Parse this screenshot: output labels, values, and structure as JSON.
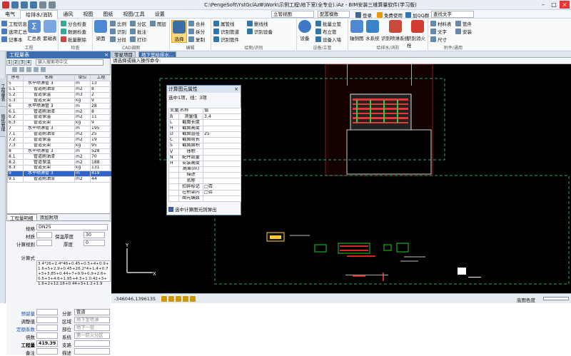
{
  "title": "C:\\PengeSoft\\YstGclAzⅢ\\Work\\示例工程\\地下室(全专业).iAz - BIM安装三维算量软件(学习版)",
  "menus": [
    "电气",
    "给排水/消防",
    "通风",
    "视图",
    "图纸",
    "视图/工具",
    "设置"
  ],
  "active_menu": "给排水/消防",
  "ribbon": {
    "engineering": {
      "items": [
        "工程信息",
        "选项汇总",
        "记事本",
        "汇总表",
        "套磁表"
      ],
      "label": "工程"
    },
    "check": {
      "items": [
        "分合检查",
        "数据检查",
        "批量删除"
      ],
      "label": "检查"
    },
    "cad": {
      "items": [
        "比例",
        "分区",
        "识别",
        "分段",
        "批注",
        "打印",
        "图层",
        "梁面"
      ],
      "label": "CAD调图"
    },
    "edit": {
      "items": [
        "选择",
        "合并",
        "拆分",
        "复制"
      ],
      "label": "编辑"
    },
    "draw": {
      "items": [
        "属管线",
        "识别管道",
        "识别管件",
        "删线线",
        "识别设备"
      ],
      "label": "绘制/识别"
    },
    "equip": {
      "items": [
        "设备",
        "批量立管",
        "布立管",
        "设备入墙"
      ],
      "label": "设备/立管"
    },
    "fire": {
      "items": [
        "轴侧图",
        "水系统",
        "识别喷淋系统",
        "识别消火栓"
      ],
      "label": "给排水/消防"
    },
    "misc": {
      "items": [
        "材料表",
        "管件",
        "文字",
        "安装",
        "尺寸"
      ],
      "label": "附件/通用"
    },
    "view_select": "立管视图",
    "match_select": "配置模数",
    "login": "登录",
    "fav": "免费使用",
    "qq": "加QQ群",
    "search": "查找文字"
  },
  "panel": {
    "title": "工程量表",
    "search_placeholder": "输入搜索项中文",
    "sidetabs": [
      "工程量表",
      "图纸管理"
    ],
    "columns": [
      "序号",
      "名称",
      "单位",
      "工程"
    ],
    "rows": [
      {
        "n": "5",
        "name": "水平喷淋管 3",
        "u": "m",
        "v": "13"
      },
      {
        "n": "5.1",
        "name": "管道刷油漆",
        "u": "m2",
        "v": "8"
      },
      {
        "n": "5.2",
        "name": "管道保温",
        "u": "m3",
        "v": "2"
      },
      {
        "n": "5.3",
        "name": "管道支架",
        "u": "kg",
        "v": "9"
      },
      {
        "n": "6",
        "name": "水平喷淋管 3",
        "u": "m",
        "v": "28"
      },
      {
        "n": "6.1",
        "name": "管道刷油漆",
        "u": "m2",
        "v": "8"
      },
      {
        "n": "6.2",
        "name": "管道保温",
        "u": "m2",
        "v": "11"
      },
      {
        "n": "6.3",
        "name": "管道支架",
        "u": "kg",
        "v": "9"
      },
      {
        "n": "7",
        "name": "水平喷淋管 3",
        "u": "m",
        "v": "195"
      },
      {
        "n": "7.1",
        "name": "管道刷油漆",
        "u": "m2",
        "v": "25"
      },
      {
        "n": "7.2",
        "name": "管道保温",
        "u": "m2",
        "v": "19"
      },
      {
        "n": "7.3",
        "name": "管道支架",
        "u": "kg",
        "v": "95"
      },
      {
        "n": "8",
        "name": "水平喷淋管 3",
        "u": "m",
        "v": "528"
      },
      {
        "n": "8.1",
        "name": "管道刷油漆",
        "u": "m2",
        "v": "70"
      },
      {
        "n": "8.2",
        "name": "管道保温",
        "u": "m2",
        "v": "188"
      },
      {
        "n": "8.3",
        "name": "管道支架",
        "u": "kg",
        "v": "131"
      },
      {
        "n": "9",
        "name": "水平喷淋管 3",
        "u": "m",
        "v": "419"
      },
      {
        "n": "9.1",
        "name": "管道刷油漆",
        "u": "m2",
        "v": "44"
      }
    ],
    "selected_row": 16,
    "detail_tabs": [
      "工程量明细",
      "添加附项"
    ],
    "props": {
      "spec_label": "规格",
      "spec": "DN25",
      "material_label": "材质",
      "insulation_label": "保温厚度",
      "insulation": "30",
      "rule_label": "计算规则",
      "thickness_label": "厚度",
      "thickness": "0",
      "formula_label": "计算式",
      "formula": "3.4*26+2.4*46+0.45+0.5+4+0.9+1.6+5+2.9+0.45+26.2*4+1.4+0.7+3+3.85+0.44+7+0.9+0.9+2.6+0.5+3+4.6+1.95+4.3+1.0.42+3+1.6+2+12.18+0.44+3+1.2+1.9",
      "config_label": "预留量",
      "partition_label": "分部",
      "partition": "管道",
      "adjust_label": "调整值",
      "area_label": "区域",
      "area": "地下室喷淋",
      "fixed_label": "定额系数",
      "part_label": "部位",
      "part": "地下一层",
      "multiple_label": "倍数",
      "system_label": "系统",
      "system": "第一防火分区",
      "quantity_label": "工程量",
      "quantity": "419.39",
      "support_label": "支路",
      "note_label": "备注",
      "desc_label": "描述"
    }
  },
  "doc_tabs": [
    "零星项目",
    "地下室给排水..."
  ],
  "command": "请选择或输入操作命令:",
  "dialog": {
    "title": "计算图元属性",
    "subtitle": "选中1项，线：3项",
    "head": [
      "变量",
      "名称",
      "值"
    ],
    "rows": [
      {
        "k": "B",
        "name": "测量值",
        "v": "3.4"
      },
      {
        "k": "L",
        "name": "截面长度",
        "v": ""
      },
      {
        "k": "H",
        "name": "截面高度",
        "v": ""
      },
      {
        "k": "D",
        "name": "截面直径",
        "v": "25"
      },
      {
        "k": "C",
        "name": "截面周长",
        "v": ""
      },
      {
        "k": "S",
        "name": "截面面积",
        "v": ""
      },
      {
        "k": "V",
        "name": "体积",
        "v": ""
      },
      {
        "k": "N",
        "name": "配件数量",
        "v": ""
      },
      {
        "k": "H",
        "name": "安装高度",
        "v": ""
      },
      {
        "k": "",
        "name": "高差(m)",
        "v": ""
      },
      {
        "k": "",
        "name": "描述",
        "v": ""
      },
      {
        "k": "",
        "name": "名称",
        "v": ""
      },
      {
        "k": "",
        "name": "扣碎标记",
        "v": "□否"
      },
      {
        "k": "",
        "name": "在桥架内",
        "v": "□否"
      },
      {
        "k": "",
        "name": "图元编数",
        "v": ""
      }
    ],
    "footer": "选中计算图元则弹出"
  },
  "status": {
    "coords": "-346046,1396135",
    "right_label": "底图色度"
  },
  "colors": {
    "accent": "#2e64c7",
    "canvas": "#000000",
    "red": "#cc2222",
    "green": "#22cc44"
  }
}
